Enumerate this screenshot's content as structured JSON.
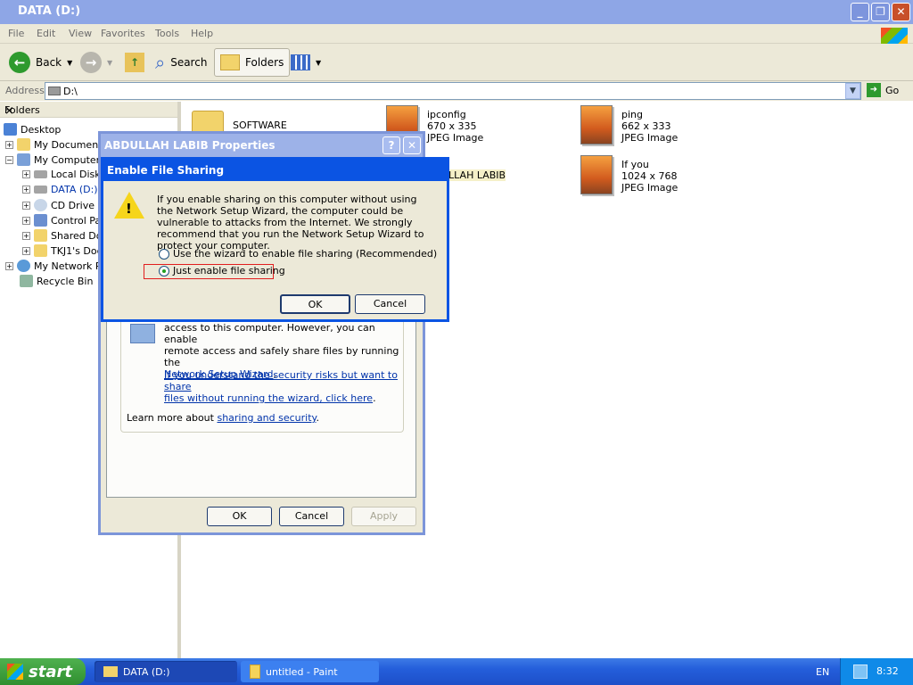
{
  "window": {
    "title": "DATA (D:)"
  },
  "menu": [
    "File",
    "Edit",
    "View",
    "Favorites",
    "Tools",
    "Help"
  ],
  "toolbar": {
    "back": "Back",
    "search": "Search",
    "folders": "Folders"
  },
  "address": {
    "label": "Address",
    "value": "D:\\",
    "go": "Go"
  },
  "folders_pane": {
    "title": "Folders",
    "close": "×",
    "items": [
      "Desktop",
      "My Documents",
      "My Computer",
      "Local Disk",
      "DATA (D:)",
      "CD Drive (",
      "Control Pa",
      "Shared Do",
      "TKJ1's Doc",
      "My Network Pl",
      "Recycle Bin"
    ]
  },
  "files": [
    {
      "name": "SOFTWARE",
      "dims": "",
      "type": ""
    },
    {
      "name": "ipconfig",
      "dims": "670 x 335",
      "type": "JPEG Image"
    },
    {
      "name": "ping",
      "dims": "662 x 333",
      "type": "JPEG Image"
    },
    {
      "name": "ULLAH LABIB",
      "dims": "",
      "type": ""
    },
    {
      "name": "If you",
      "dims": "1024 x 768",
      "type": "JPEG Image"
    }
  ],
  "properties_dialog": {
    "title": "ABDULLAH LABIB Properties",
    "help": "?",
    "close": "✕",
    "text1": "access to this computer. However, you can enable",
    "text2": "remote access and safely share files by running the",
    "link_wizard": "Network Setup Wizard",
    "dot": ".",
    "link_risk1": "If you understand the security risks but want to share",
    "link_risk2": "files without running the wizard, click here",
    "learn_prefix": "Learn more about ",
    "learn_link": "sharing and security",
    "ok": "OK",
    "cancel": "Cancel",
    "apply": "Apply"
  },
  "efs_dialog": {
    "title": "Enable File Sharing",
    "message": "If you enable sharing on this computer without using the Network Setup Wizard, the computer could be vulnerable to attacks from the Internet. We strongly recommend that you run the Network Setup Wizard to protect your computer.",
    "option1": "Use the wizard to enable file sharing (Recommended)",
    "option2": "Just enable file sharing",
    "selected_option": "option2",
    "ok": "OK",
    "cancel": "Cancel"
  },
  "taskbar": {
    "start": "start",
    "tasks": [
      "DATA (D:)",
      "untitled - Paint"
    ],
    "language": "EN",
    "time": "8:32"
  },
  "colors": {
    "titlebar": "#8ea6e6",
    "dialog_active": "#0b54e3",
    "taskbar": "#245edb",
    "start": "#2f8f2f",
    "highlight_box": "#e11e1e"
  }
}
